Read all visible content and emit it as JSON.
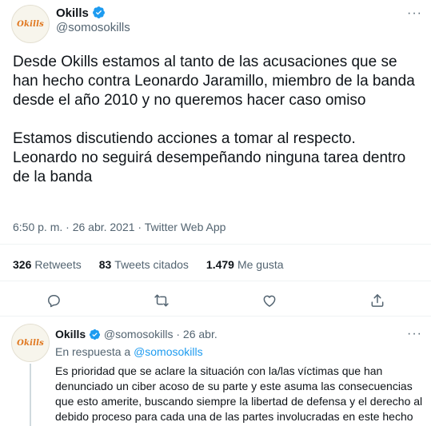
{
  "tweet": {
    "avatar_text": "Okills",
    "display_name": "Okills",
    "handle": "@somosokills",
    "more_label": "···",
    "text_paragraphs": [
      "Desde Okills estamos al tanto de las acusaciones que se han hecho contra Leonardo Jaramillo, miembro de la banda desde el año 2010 y no queremos hacer caso omiso",
      "Estamos discutiendo acciones a tomar al respecto. Leonardo no seguirá desempeñando ninguna tarea dentro de la banda"
    ],
    "timestamp": "6:50 p. m. · 26 abr. 2021 · Twitter Web App",
    "stats": {
      "retweets_count": "326",
      "retweets_label": "Retweets",
      "quotes_count": "83",
      "quotes_label": "Tweets citados",
      "likes_count": "1.479",
      "likes_label": "Me gusta"
    },
    "action_icons": [
      "reply-icon",
      "retweet-icon",
      "like-icon",
      "share-icon"
    ]
  },
  "reply": {
    "avatar_text": "Okills",
    "display_name": "Okills",
    "handle_and_date": "@somosokills · 26 abr.",
    "more_label": "···",
    "in_reply_prefix": "En respuesta a",
    "in_reply_mention": "@somosokills",
    "text": "Es prioridad que se aclare la situación con la/las víctimas que han denunciado un ciber acoso de su parte y este asuma las consecuencias que esto amerite, buscando siempre la libertad de defensa y el derecho al debido proceso para cada una de las partes involucradas en este hecho"
  },
  "colors": {
    "accent": "#1d9bf0",
    "secondary_text": "#536471",
    "logo": "#e0761d"
  }
}
